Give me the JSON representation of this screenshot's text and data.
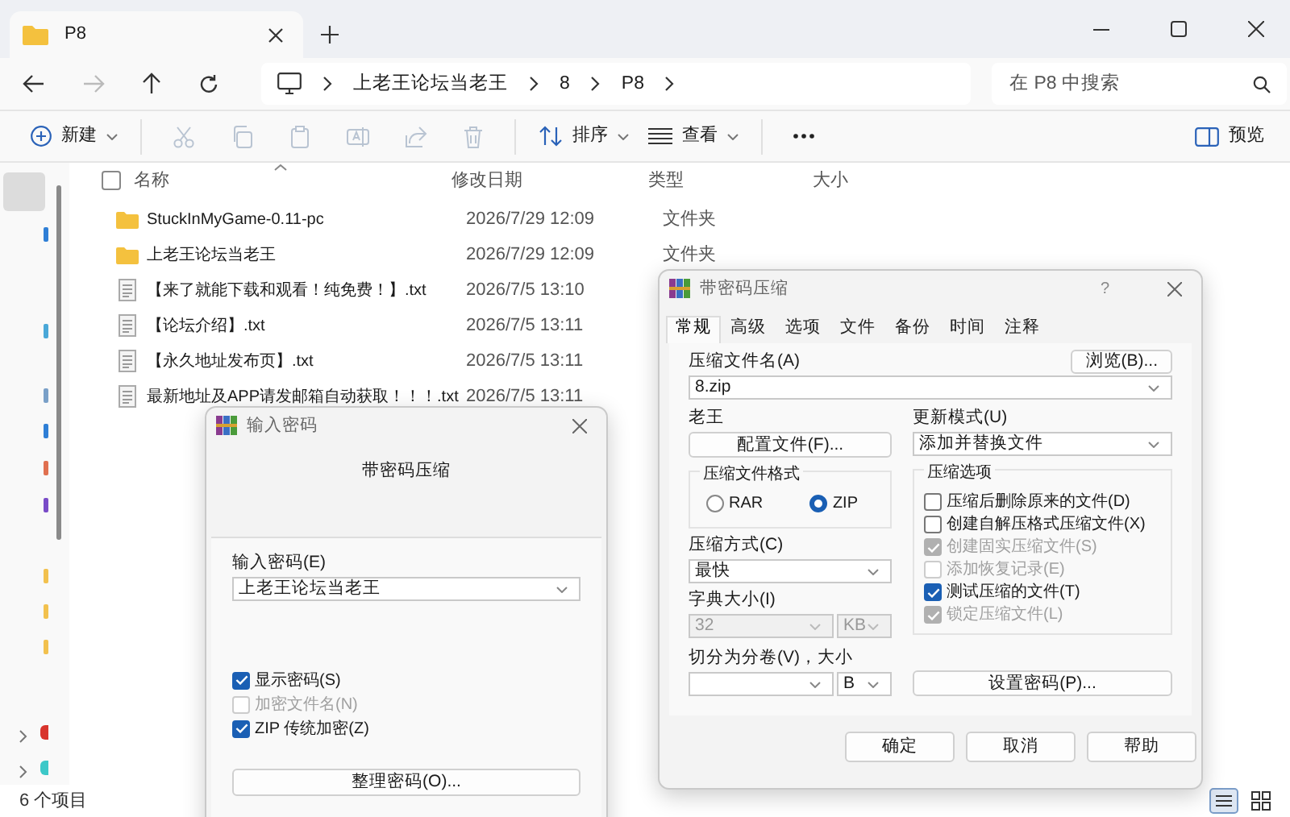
{
  "explorer": {
    "tab_title": "P8",
    "breadcrumb": [
      "上老王论坛当老王",
      "8",
      "P8"
    ],
    "search": {
      "placeholder": "在 P8 中搜索"
    },
    "toolbar": {
      "new": "新建",
      "sort": "排序",
      "view": "查看",
      "preview": "预览"
    },
    "select_all_checked": false,
    "columns": [
      "名称",
      "修改日期",
      "类型",
      "大小"
    ],
    "files": [
      {
        "kind": "folder",
        "name": "StuckInMyGame-0.11-pc",
        "date": "2026/7/29 12:09",
        "type": "文件夹"
      },
      {
        "kind": "folder",
        "name": "上老王论坛当老王",
        "date": "2026/7/29 12:09",
        "type": "文件夹"
      },
      {
        "kind": "text",
        "name": "【来了就能下载和观看！纯免费！】.txt",
        "date": "2026/7/5 13:10"
      },
      {
        "kind": "text",
        "name": "【论坛介绍】.txt",
        "date": "2026/7/5 13:11"
      },
      {
        "kind": "text",
        "name": "【永久地址发布页】.txt",
        "date": "2026/7/5 13:11"
      },
      {
        "kind": "text",
        "name": "最新地址及APP请发邮箱自动获取！！！.txt",
        "date": "2026/7/5 13:11"
      }
    ],
    "status": "6 个项目"
  },
  "password_dialog": {
    "title": "输入密码",
    "heading": "带密码压缩",
    "password_label": "输入密码(E)",
    "password_value": "上老王论坛当老王",
    "options": [
      {
        "label": "显示密码(S)",
        "checked": true,
        "disabled": false
      },
      {
        "label": "加密文件名(N)",
        "checked": false,
        "disabled": true
      },
      {
        "label": "ZIP 传统加密(Z)",
        "checked": true,
        "disabled": false
      }
    ],
    "organize_button": "整理密码(O)..."
  },
  "archive_dialog": {
    "title": "带密码压缩",
    "help": "?",
    "tabs": [
      {
        "label": "常规",
        "selected": true
      },
      {
        "label": "高级",
        "selected": false
      },
      {
        "label": "选项",
        "selected": false
      },
      {
        "label": "文件",
        "selected": false
      },
      {
        "label": "备份",
        "selected": false
      },
      {
        "label": "时间",
        "selected": false
      },
      {
        "label": "注释",
        "selected": false
      }
    ],
    "archive_name_label": "压缩文件名(A)",
    "browse_button": "浏览(B)...",
    "archive_name": "8.zip",
    "profile_label": "老王",
    "profile_button": "配置文件(F)...",
    "update_mode_label": "更新模式(U)",
    "update_mode": "添加并替换文件",
    "format_group": "压缩文件格式",
    "formats": [
      {
        "label": "RAR",
        "selected": false
      },
      {
        "label": "ZIP",
        "selected": true
      }
    ],
    "method_label": "压缩方式(C)",
    "method": "最快",
    "dict_label": "字典大小(I)",
    "dict_size": "32",
    "dict_unit": "KB",
    "split_label": "切分为分卷(V)，大小",
    "split_unit": "B",
    "options_group": "压缩选项",
    "options": [
      {
        "label": "压缩后删除原来的文件(D)",
        "checked": false,
        "disabled": false
      },
      {
        "label": "创建自解压格式压缩文件(X)",
        "checked": false,
        "disabled": false
      },
      {
        "label": "创建固实压缩文件(S)",
        "checked": true,
        "disabled": true
      },
      {
        "label": "添加恢复记录(E)",
        "checked": false,
        "disabled": true
      },
      {
        "label": "测试压缩的文件(T)",
        "checked": true,
        "disabled": false
      },
      {
        "label": "锁定压缩文件(L)",
        "checked": true,
        "disabled": true
      }
    ],
    "password_button": "设置密码(P)...",
    "buttons": [
      "确定",
      "取消",
      "帮助"
    ]
  }
}
